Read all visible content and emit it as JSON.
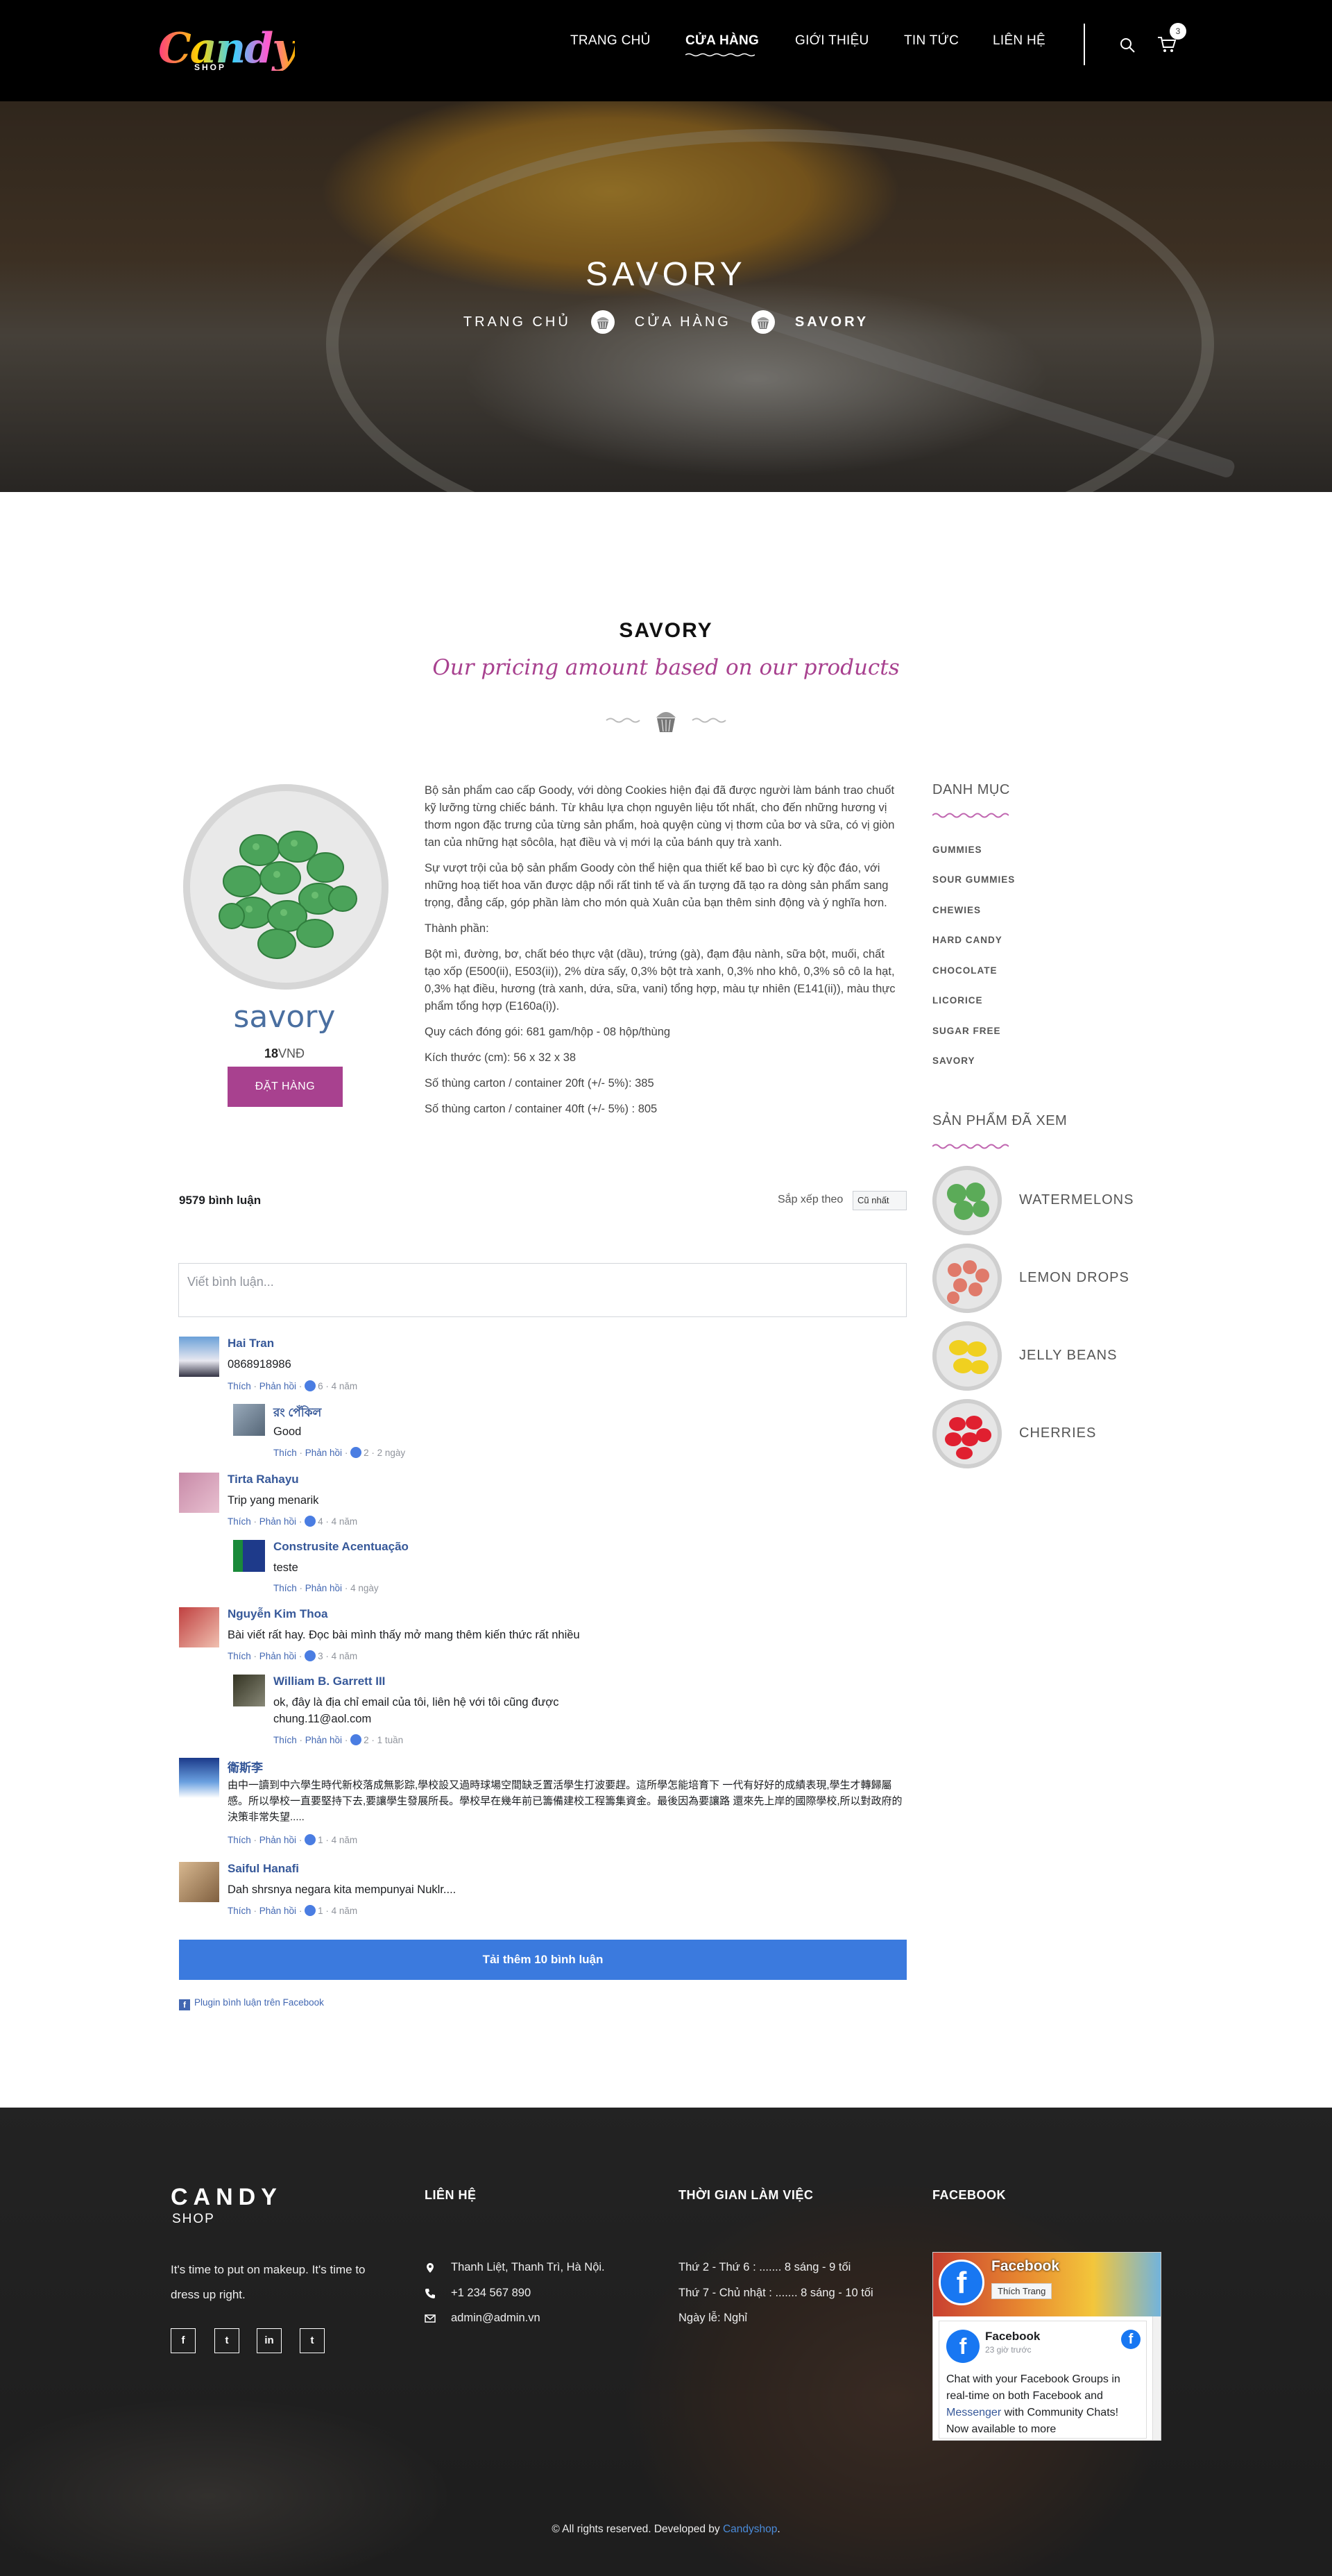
{
  "header": {
    "logo_text": "Candy",
    "logo_sub": "SHOP",
    "nav": [
      "TRANG CHỦ",
      "CỬA HÀNG",
      "GIỚI THIỆU",
      "TIN TỨC",
      "LIÊN HỆ"
    ],
    "active_nav": "CỬA HÀNG",
    "cart_count": "3",
    "icons": {
      "search": "search-icon",
      "cart": "cart-icon"
    }
  },
  "hero": {
    "title": "SAVORY",
    "breadcrumbs": [
      "TRANG CHỦ",
      "CỬA HÀNG",
      "SAVORY"
    ]
  },
  "section": {
    "title": "SAVORY",
    "subtitle": "Our pricing amount based on our products"
  },
  "product": {
    "name": "savory",
    "price_value": "18",
    "price_unit": "VNĐ",
    "order_label": "ĐẶT HÀNG",
    "description": [
      "Bộ sản phẩm cao cấp Goody, với dòng Cookies hiện đại đã được người làm bánh trao chuốt kỹ lưỡng từng chiếc bánh. Từ khâu lựa chọn nguyên liệu tốt nhất, cho đến những hương vị thơm ngon đặc trưng của từng sản phẩm, hoà quyện cùng vị thơm của bơ và sữa, có vị giòn tan của những hạt sôcôla, hạt điều và vị mới lạ của bánh quy trà xanh.",
      "Sự vượt trội của bộ sản phẩm Goody còn thể hiện qua thiết kế bao bì cực kỳ độc đáo, với những hoạ tiết hoa văn được dập nổi rất tinh tế và ấn tượng đã tạo ra dòng sản phẩm sang trọng, đẳng cấp, góp phần làm cho món quà Xuân của bạn thêm sinh động và ý nghĩa hơn.",
      "Thành phần:",
      "Bột mì, đường, bơ, chất béo thực vật (dầu), trứng (gà), đạm đậu nành, sữa bột, muối, chất tạo xốp (E500(ii), E503(ii)), 2% dừa sấy, 0,3% bột trà xanh, 0,3% nho khô, 0,3% sô cô la hạt, 0,3% hạt điều, hương (trà xanh, dứa, sữa, vani) tổng hợp, màu tự nhiên (E141(ii)), màu thực phẩm tổng hợp (E160a(i)).",
      "Quy cách đóng gói: 681 gam/hộp - 08 hộp/thùng",
      "Kích thước (cm): 56 x 32 x 38",
      "Số thùng carton / container 20ft (+/- 5%): 385",
      "Số thùng carton / container 40ft (+/- 5%) : 805"
    ]
  },
  "sidebar": {
    "categories_title": "DANH MỤC",
    "categories": [
      "GUMMIES",
      "SOUR GUMMIES",
      "CHEWIES",
      "HARD CANDY",
      "CHOCOLATE",
      "LICORICE",
      "SUGAR FREE",
      "SAVORY"
    ],
    "seen_title": "SẢN PHẨM ĐÃ XEM",
    "seen": [
      "WATERMELONS",
      "LEMON DROPS",
      "JELLY BEANS",
      "CHERRIES"
    ],
    "seen_colors": [
      "#5bab58",
      "#e07a6a",
      "#f0d020",
      "#e02030"
    ]
  },
  "comments": {
    "count": "9579 bình luận",
    "sort_label": "Sắp xếp theo",
    "sort_value": "Cũ nhất",
    "input_placeholder": "Viết bình luận...",
    "like": "Thích",
    "reply": "Phản hồi",
    "items": [
      {
        "name": "Hai Tran",
        "text": "0868918986",
        "likes": "6",
        "time": "4 năm"
      },
      {
        "name": "রং পেঁকিল",
        "text": "Good",
        "likes": "2",
        "time": "2 ngày"
      },
      {
        "name": "Tirta Rahayu",
        "text": "Trip yang menarik",
        "likes": "4",
        "time": "4 năm"
      },
      {
        "name": "Construsite Acentuação",
        "text": "teste",
        "time": "4 ngày"
      },
      {
        "name": "Nguyễn Kim Thoa",
        "text": "Bài viết rất hay. Đọc bài mình thấy mở mang thêm kiến thức rất nhiều",
        "likes": "3",
        "time": "4 năm"
      },
      {
        "name": "William B. Garrett III",
        "text": "ok, đây là địa chỉ email của tôi, liên hệ với tôi cũng được chung.11@aol.com",
        "likes": "2",
        "time": "1 tuần"
      },
      {
        "name": "衛斯李",
        "text": "由中一讀到中六學生時代新校落成無影踪,學校設又過時球場空間缺乏置活學生打波要趕。這所學怎能培育下 一代有好好的成績表現,學生才轉歸屬感。所以學校一直要堅持下去,要讓學生發展所長。學校早在幾年前已籌備建校工程籌集資金。最後因為要讓路 還來先上岸的國際學校,所以對政府的決策非常失望.....",
        "likes": "1",
        "time": "4 năm"
      },
      {
        "name": "Saiful Hanafi",
        "text": "Dah shrsnya negara kita mempunyai Nuklr....",
        "likes": "1",
        "time": "4 năm"
      }
    ],
    "load_more": "Tải thêm 10 bình luận",
    "plugin": "Plugin bình luận trên Facebook"
  },
  "footer": {
    "logo_big": "CANDY",
    "logo_small": "SHOP",
    "tagline": "It's time to put on makeup. It's time to dress up right.",
    "social": [
      "f",
      "t",
      "in",
      "t"
    ],
    "contact_title": "LIÊN HỆ",
    "address": "Thanh Liệt, Thanh Trì, Hà Nội.",
    "phone": "+1 234 567 890",
    "email": "admin@admin.vn",
    "hours_title": "THỜI GIAN LÀM VIỆC",
    "hours": [
      "Thứ 2 - Thứ 6 : ....... 8 sáng - 9 tối",
      "Thứ 7 - Chủ nhật : ....... 8 sáng - 10 tối",
      "Ngày lễ: Nghỉ"
    ],
    "facebook_title": "FACEBOOK",
    "fb_page_name": "Facebook",
    "fb_like": "Thích Trang",
    "fb_post_name": "Facebook",
    "fb_post_time": "23 giờ trước",
    "fb_post_text_1": "Chat with your Facebook Groups in real-time on both Facebook and ",
    "fb_post_link": "Messenger",
    "fb_post_text_2": " with Community Chats! Now available to more",
    "copyright": "© All rights reserved. Developed by ",
    "developer": "Candyshop"
  }
}
